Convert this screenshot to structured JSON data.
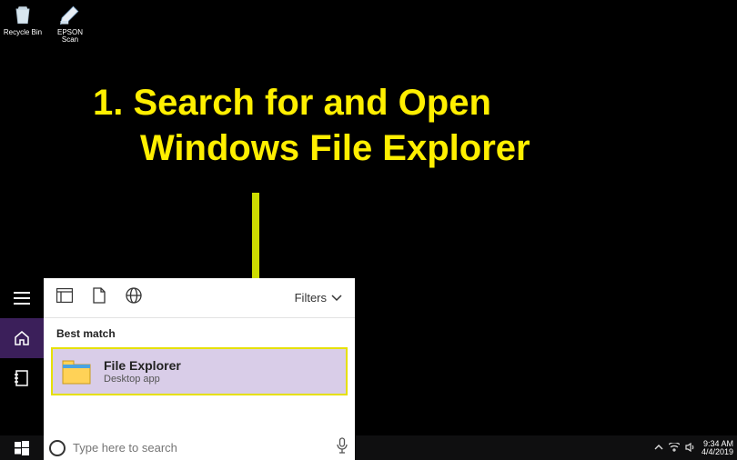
{
  "desktop": {
    "icons": [
      {
        "label": "Recycle Bin"
      },
      {
        "label": "EPSON Scan"
      }
    ]
  },
  "annotation": {
    "line1": "1. Search for and Open",
    "line2": "Windows File Explorer",
    "color": "#ffef00"
  },
  "search_panel": {
    "filters_label": "Filters",
    "section_label": "Best match",
    "result": {
      "title": "File Explorer",
      "subtitle": "Desktop app"
    }
  },
  "search_box": {
    "placeholder": "Type here to search",
    "value": ""
  },
  "systray": {
    "time": "9:34 AM",
    "date": "4/4/2019"
  }
}
